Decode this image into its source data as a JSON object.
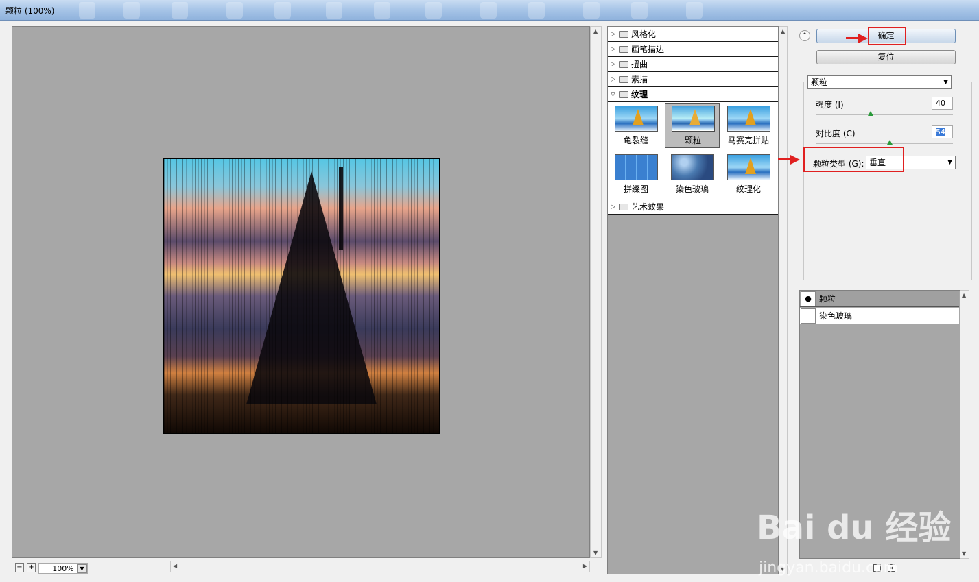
{
  "window": {
    "title": "颗粒 (100%)"
  },
  "preview": {
    "zoom": "100%"
  },
  "gallery": {
    "categories": [
      {
        "label": "风格化",
        "expanded": false
      },
      {
        "label": "画笔描边",
        "expanded": false
      },
      {
        "label": "扭曲",
        "expanded": false
      },
      {
        "label": "素描",
        "expanded": false
      },
      {
        "label": "纹理",
        "expanded": true
      },
      {
        "label": "艺术效果",
        "expanded": false
      }
    ],
    "texture_filters": [
      {
        "label": "龟裂缝",
        "selected": false
      },
      {
        "label": "颗粒",
        "selected": true
      },
      {
        "label": "马赛克拼贴",
        "selected": false
      },
      {
        "label": "拼缀图",
        "selected": false
      },
      {
        "label": "染色玻璃",
        "selected": false
      },
      {
        "label": "纹理化",
        "selected": false
      }
    ]
  },
  "buttons": {
    "ok": "确定",
    "reset": "复位"
  },
  "settings": {
    "filter_select": "颗粒",
    "intensity_label": "强度 (I)",
    "intensity_value": "40",
    "intensity_fraction": 0.4,
    "contrast_label": "对比度 (C)",
    "contrast_value": "54",
    "contrast_fraction": 0.54,
    "grain_type_label": "颗粒类型 (G):",
    "grain_type_value": "垂直"
  },
  "layers": [
    {
      "name": "颗粒",
      "visible": true
    },
    {
      "name": "染色玻璃",
      "visible": false
    }
  ],
  "watermark": {
    "brand": "Bai du 经验",
    "url": "jingyan.baidu.com"
  },
  "colors": {
    "annotation": "#e02020",
    "canvas_gray": "#a7a7a7"
  }
}
